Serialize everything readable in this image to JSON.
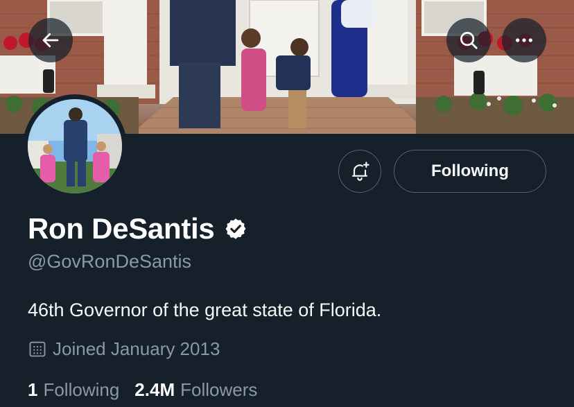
{
  "profile": {
    "display_name": "Ron DeSantis",
    "handle": "@GovRonDeSantis",
    "bio": "46th Governor of the great state of Florida.",
    "joined": "Joined January 2013",
    "verified": true
  },
  "stats": {
    "following_count": "1",
    "following_label": "Following",
    "followers_count": "2.4M",
    "followers_label": "Followers"
  },
  "actions": {
    "follow_state_label": "Following"
  },
  "icons": {
    "back": "back-arrow-icon",
    "search": "search-icon",
    "more": "more-icon",
    "notify": "bell-plus-icon",
    "verified": "verified-badge-icon",
    "calendar": "calendar-icon"
  },
  "colors": {
    "background": "#15202b",
    "secondary_text": "#8b98a5",
    "border": "#536471",
    "primary_text": "#ffffff"
  }
}
